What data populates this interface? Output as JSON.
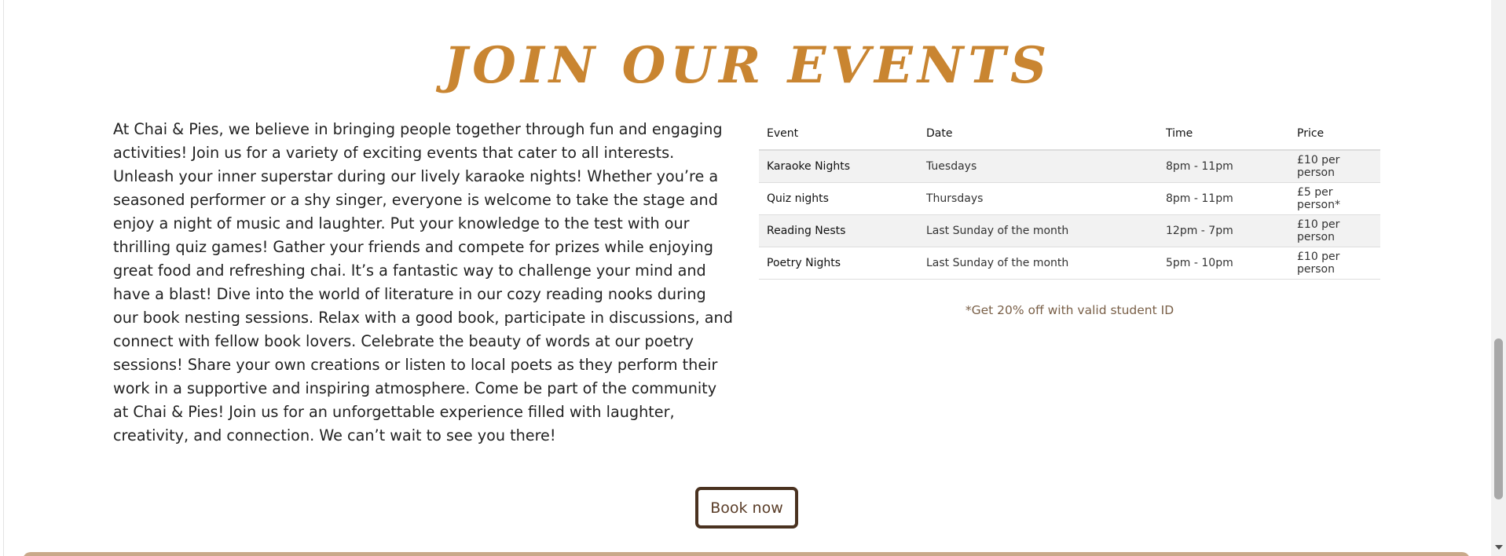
{
  "section": {
    "heading": "JOIN OUR EVENTS",
    "intro_text": "At Chai & Pies, we believe in bringing people together through fun and engaging activities! Join us for a variety of exciting events that cater to all interests. Unleash your inner superstar during our lively karaoke nights! Whether you’re a seasoned performer or a shy singer, everyone is welcome to take the stage and enjoy a night of music and laughter. Put your knowledge to the test with our thrilling quiz games! Gather your friends and compete for prizes while enjoying great food and refreshing chai. It’s a fantastic way to challenge your mind and have a blast! Dive into the world of literature in our cozy reading nooks during our book nesting sessions. Relax with a good book, participate in discussions, and connect with fellow book lovers. Celebrate the beauty of words at our poetry sessions! Share your own creations or listen to local poets as they perform their work in a supportive and inspiring atmosphere. Come be part of the community at Chai & Pies! Join us for an unforgettable experience filled with laughter, creativity, and connection. We can’t wait to see you there!"
  },
  "table": {
    "headers": [
      "Event",
      "Date",
      "Time",
      "Price"
    ],
    "rows": [
      [
        "Karaoke Nights",
        "Tuesdays",
        "8pm - 11pm",
        "£10 per person"
      ],
      [
        "Quiz nights",
        "Thursdays",
        "8pm - 11pm",
        "£5 per person*"
      ],
      [
        "Reading Nests",
        "Last Sunday of the month",
        "12pm - 7pm",
        "£10 per person"
      ],
      [
        "Poetry Nights",
        "Last Sunday of the month",
        "5pm - 10pm",
        "£10 per person"
      ]
    ],
    "footnote": "*Get 20% off with valid student ID"
  },
  "actions": {
    "book_label": "Book now"
  },
  "colors": {
    "heading": "#c98531",
    "button_border": "#4a3220",
    "footer_strip": "#c9a98a",
    "row_stripe": "#f2f2f2"
  }
}
